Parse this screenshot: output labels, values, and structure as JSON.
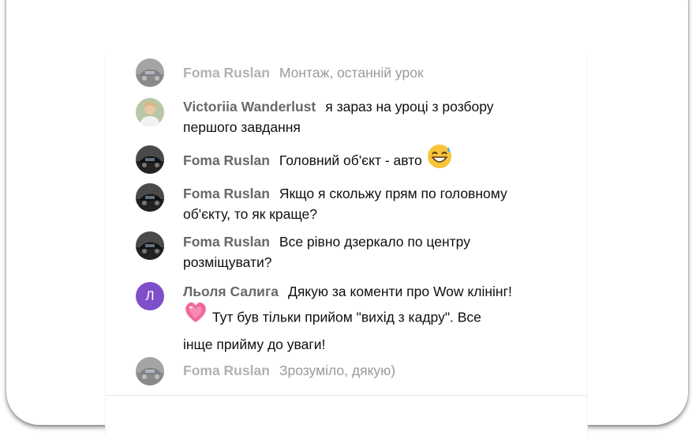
{
  "messages": [
    {
      "author": "Foma Ruslan",
      "text": "Монтаж, останній урок",
      "avatar": "car-photo-avatar"
    },
    {
      "author": "Victoriia Wanderlust",
      "text": "я зараз на уроці з розбору першого завдання",
      "avatar": "person-photo-avatar"
    },
    {
      "author": "Foma Ruslan",
      "text": "Головний об'єкт - авто",
      "emoji": "grinning-face-with-sweat-emoji",
      "avatar": "car-photo-avatar"
    },
    {
      "author": "Foma Ruslan",
      "text": "Якщо я скольжу прям по головному об'єкту, то як краще?",
      "avatar": "car-photo-avatar"
    },
    {
      "author": "Foma Ruslan",
      "text": "Все рівно дзеркало по центру розміщувати?",
      "avatar": "car-photo-avatar"
    },
    {
      "author": "Льоля Салига",
      "avatar_letter": "Л",
      "avatar_color": "#7e4fc9",
      "text_part1": "Дякую за коменти про Wow клінінг!",
      "emoji": "growing-heart-emoji",
      "text_part2": "Тут був тільки прийом \"вихід з кадру\". Все інще прийму до уваги!"
    },
    {
      "author": "Foma Ruslan",
      "text": "Зрозуміло, дякую)",
      "avatar": "car-photo-avatar"
    }
  ]
}
